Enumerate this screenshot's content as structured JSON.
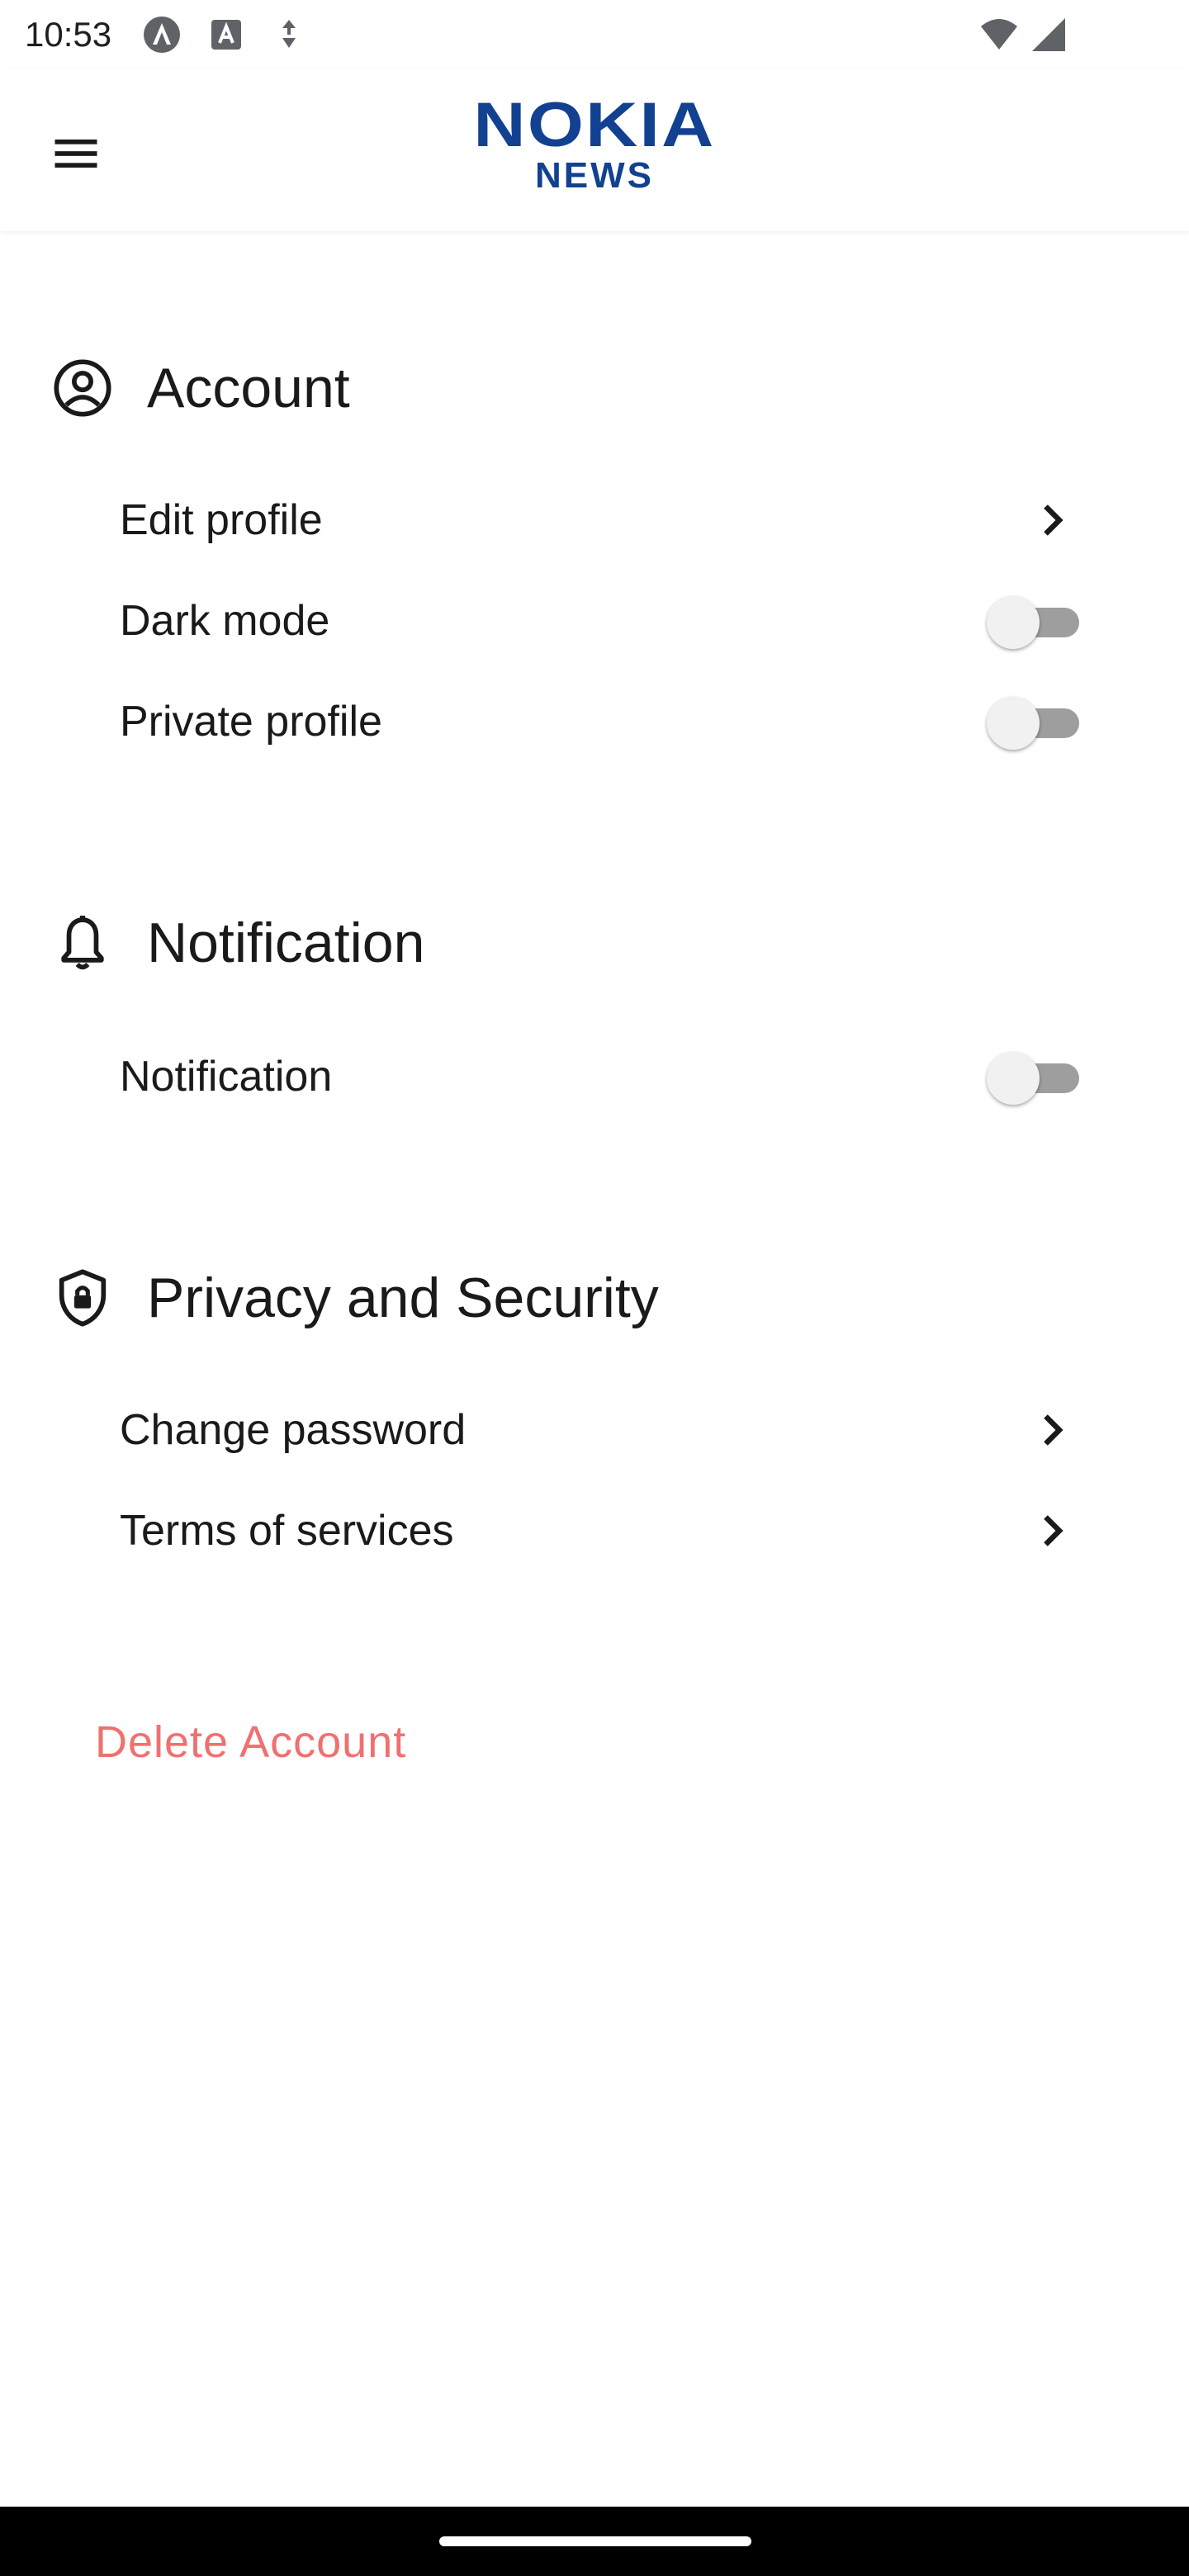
{
  "status_bar": {
    "time": "10:53",
    "icons": [
      "app-notification-icon",
      "text-notification-icon",
      "vpn-key-icon",
      "wifi-icon",
      "cell-signal-icon"
    ]
  },
  "app_bar": {
    "menu_icon": "hamburger-menu-icon",
    "logo_main": "NOKIA",
    "logo_sub": "NEWS",
    "logo_color": "#124191"
  },
  "sections": {
    "account": {
      "title": "Account",
      "icon": "account-circle-icon",
      "edit_profile": "Edit profile",
      "dark_mode": "Dark mode",
      "dark_mode_on": false,
      "private_profile": "Private profile",
      "private_profile_on": false
    },
    "notification": {
      "title": "Notification",
      "icon": "bell-icon",
      "notification": "Notification",
      "notification_on": false
    },
    "privacy": {
      "title": "Privacy and Security",
      "icon": "shield-lock-icon",
      "change_password": "Change password",
      "terms": "Terms of services"
    }
  },
  "delete_account": "Delete Account",
  "colors": {
    "delete": "#f07070",
    "toggle_track_off": "#9e9e9e",
    "toggle_thumb_off": "#f1f1f1"
  }
}
